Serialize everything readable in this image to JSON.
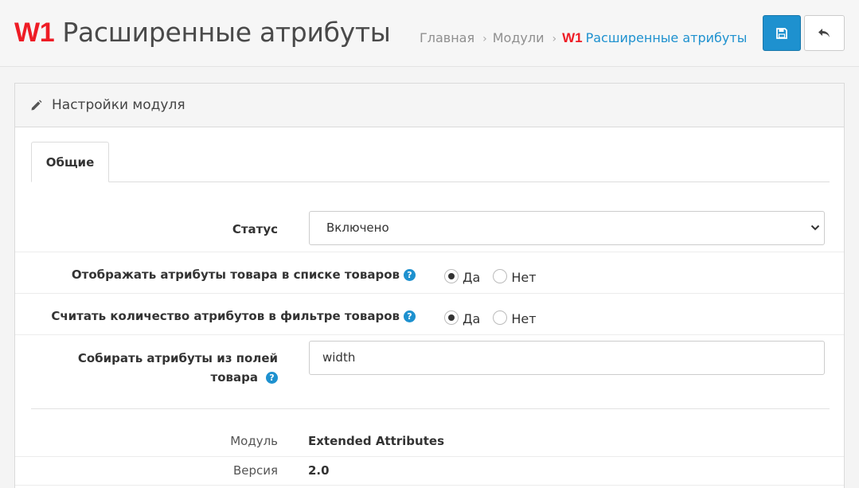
{
  "header": {
    "brand": "W1",
    "title": "Расширенные атрибуты",
    "breadcrumb": {
      "home": "Главная",
      "modules": "Модули",
      "current_brand": "W1",
      "current": "Расширенные атрибуты"
    },
    "icons": {
      "save": "save-icon",
      "back": "reply-icon"
    },
    "colors": {
      "brand": "#ee1c25",
      "accent": "#1e91cf"
    }
  },
  "panel": {
    "heading": "Настройки модуля",
    "heading_icon": "pencil-icon",
    "tab_general": "Общие"
  },
  "form": {
    "status_label": "Статус",
    "status_value": "Включено",
    "show_attrs_label": "Отображать атрибуты товара в списке товаров",
    "show_attrs_yes": "Да",
    "show_attrs_no": "Нет",
    "show_attrs_selected": "Да",
    "count_attrs_label": "Считать количество атрибутов в фильтре товаров",
    "count_attrs_yes": "Да",
    "count_attrs_no": "Нет",
    "count_attrs_selected": "Да",
    "collect_label_line1": "Собирать атрибуты из полей",
    "collect_label_line2": "товара",
    "collect_value": "width",
    "help_glyph": "?"
  },
  "info": {
    "module_label": "Модуль",
    "module_value": "Extended Attributes",
    "version_label": "Версия",
    "version_value": "2.0"
  }
}
